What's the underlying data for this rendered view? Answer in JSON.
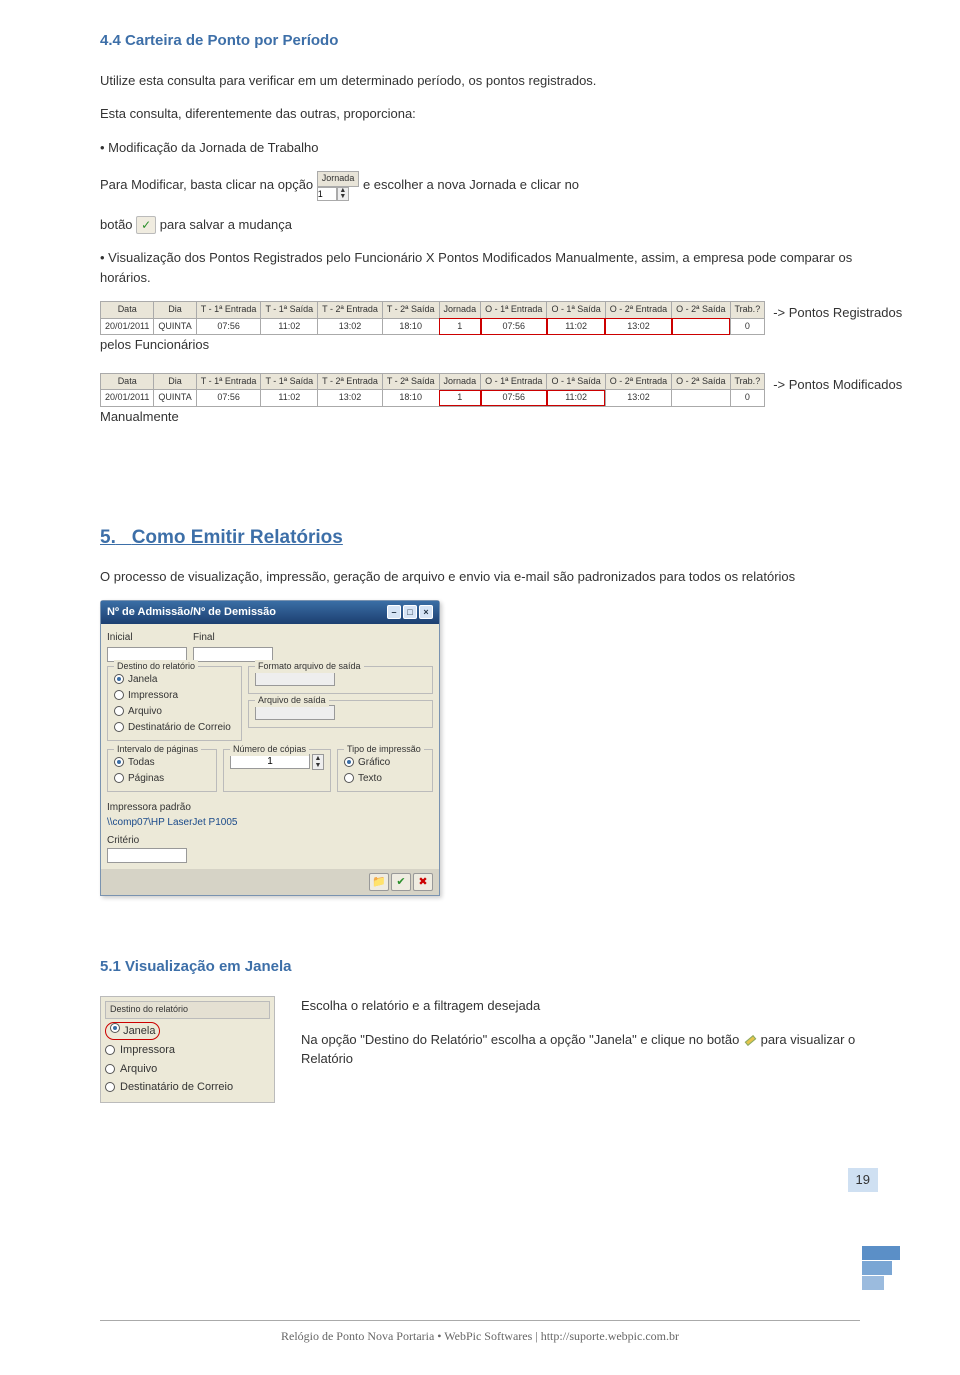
{
  "section44": {
    "title": "4.4 Carteira de Ponto por Período",
    "p1": "Utilize esta consulta para verificar em um determinado período, os pontos registrados.",
    "p2": "Esta consulta, diferentemente das outras, proporciona:",
    "b1": "Modificação da Jornada de Trabalho",
    "modify_pre": "Para Modificar, basta clicar na opção",
    "jornada_label": "Jornada",
    "jornada_value": "1",
    "modify_post": " e escolher a nova Jornada e clicar no",
    "btn_pre": "botão ",
    "ok_glyph": "✓",
    "btn_post": " para salvar a mudança",
    "b2": "Visualização dos Pontos Registrados pelo Funcionário X Pontos Modificados Manualmente, assim, a empresa pode comparar os horários.",
    "registrados_label": "-> Pontos Registrados",
    "registrados_suffix": "pelos Funcionários",
    "modificados_label": "-> Pontos Modificados",
    "modificados_suffix": "Manualmente"
  },
  "table": {
    "headers": [
      "Data",
      "Dia",
      "T - 1ª Entrada",
      "T - 1ª Saída",
      "T - 2ª Entrada",
      "T - 2ª Saída",
      "Jornada",
      "O - 1ª Entrada",
      "O - 1ª Saída",
      "O - 2ª Entrada",
      "O - 2ª Saída",
      "Trab.?"
    ],
    "row": [
      "20/01/2011",
      "QUINTA",
      "07:56",
      "11:02",
      "13:02",
      "18:10",
      "1",
      "07:56",
      "11:02",
      "13:02",
      "",
      "0"
    ]
  },
  "section5": {
    "number": "5.",
    "title": "Como Emitir Relatórios",
    "p1": "O processo de visualização, impressão, geração de arquivo e envio via e-mail são padronizados para todos os relatórios"
  },
  "dialog": {
    "title": "Nº de Admissão/Nº de Demissão",
    "inicial": "Inicial",
    "final": "Final",
    "grp_destino": "Destino do relatório",
    "opt_janela": "Janela",
    "opt_impressora": "Impressora",
    "opt_arquivo": "Arquivo",
    "opt_dest_correio": "Destinatário de Correio",
    "grp_formato": "Formato arquivo de saída",
    "grp_arquivo": "Arquivo de saída",
    "grp_intervalo": "Intervalo de páginas",
    "opt_todas": "Todas",
    "opt_paginas": "Páginas",
    "grp_copias": "Número de cópias",
    "copias_val": "1",
    "grp_tipo": "Tipo de impressão",
    "opt_grafico": "Gráfico",
    "opt_texto": "Texto",
    "imp_label": "Impressora padrão",
    "imp_value": "\\\\comp07\\HP LaserJet P1005",
    "criterio": "Critério",
    "bottom_btn_browse": "📁",
    "bottom_btn_ok": "✔",
    "bottom_btn_close": "✖"
  },
  "section51": {
    "title": "5.1 Visualização em Janela",
    "dest_tab": "Destino do relatório",
    "p1": "Escolha o relatório e a filtragem desejada",
    "p2_pre": "Na opção \"Destino do Relatório\" escolha a opção \"Janela\" e clique no botão ",
    "p2_post": " para visualizar o Relatório"
  },
  "page_number": "19",
  "footer": "Relógio de Ponto Nova Portaria • WebPic Softwares | http://suporte.webpic.com.br"
}
